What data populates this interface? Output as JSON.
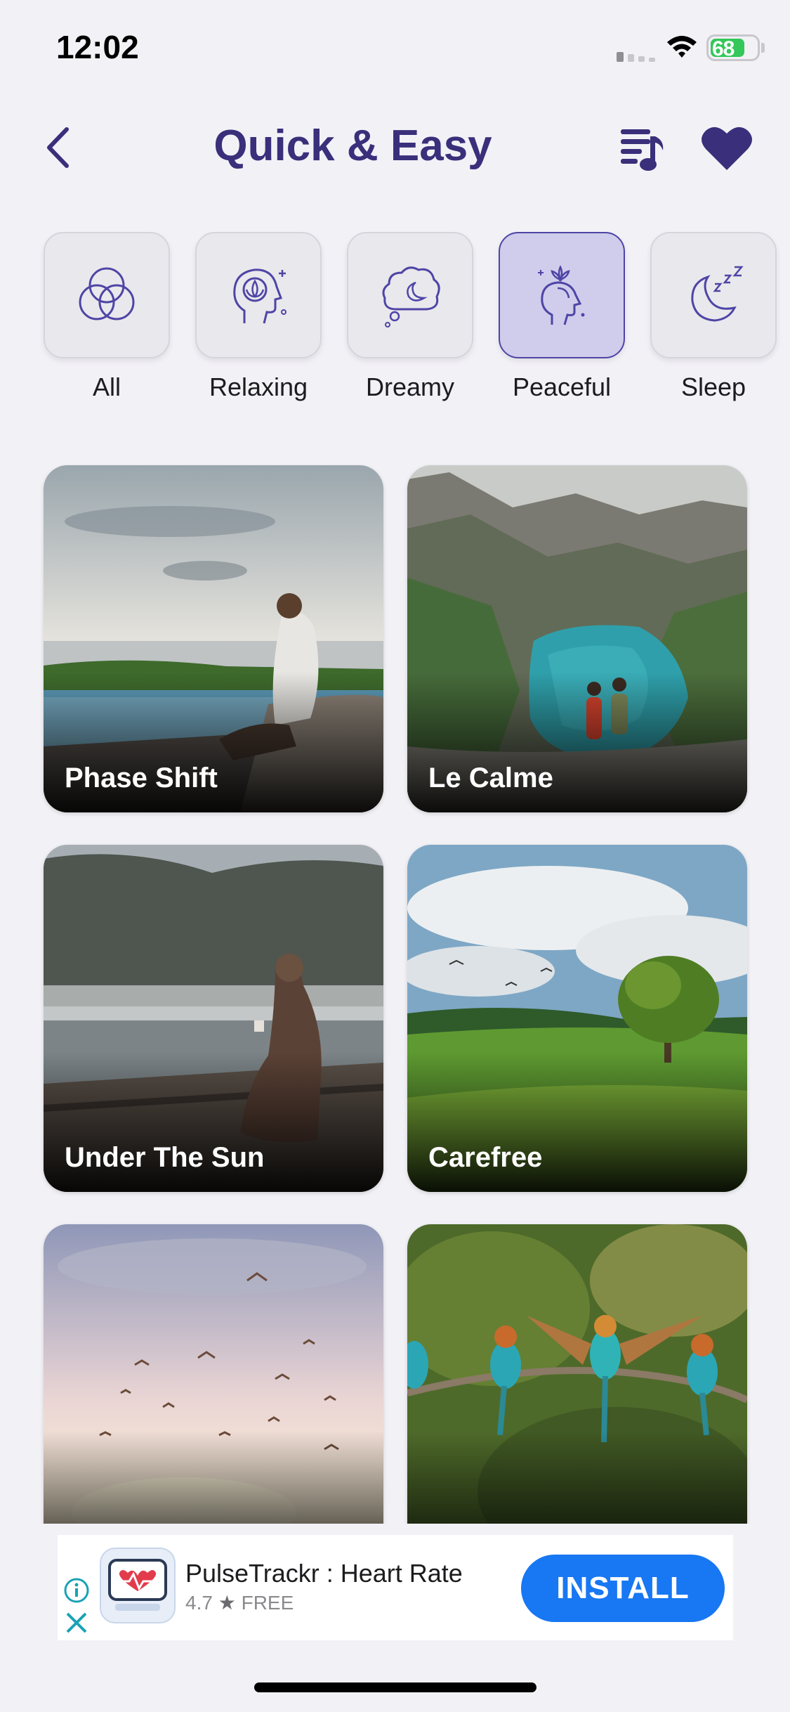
{
  "status_bar": {
    "time": "12:02",
    "battery": "68"
  },
  "header": {
    "title": "Quick & Easy"
  },
  "categories": [
    {
      "label": "All",
      "icon": "circles-icon"
    },
    {
      "label": "Relaxing",
      "icon": "head-lotus-icon"
    },
    {
      "label": "Dreamy",
      "icon": "cloud-moon-icon"
    },
    {
      "label": "Peaceful",
      "icon": "head-meditation-icon",
      "active": true
    },
    {
      "label": "Sleep",
      "icon": "moon-zzz-icon"
    }
  ],
  "cards": [
    {
      "title": "Phase Shift"
    },
    {
      "title": "Le Calme"
    },
    {
      "title": "Under The Sun"
    },
    {
      "title": "Carefree"
    },
    {
      "title": ""
    },
    {
      "title": ""
    }
  ],
  "ad": {
    "app_name": "PulseTrackr : Heart Rate",
    "rating": "4.7",
    "price": "FREE",
    "install_label": "INSTALL"
  },
  "colors": {
    "accent": "#3a2f7a",
    "active_tile": "#cfcdeb",
    "install": "#1877f2"
  }
}
